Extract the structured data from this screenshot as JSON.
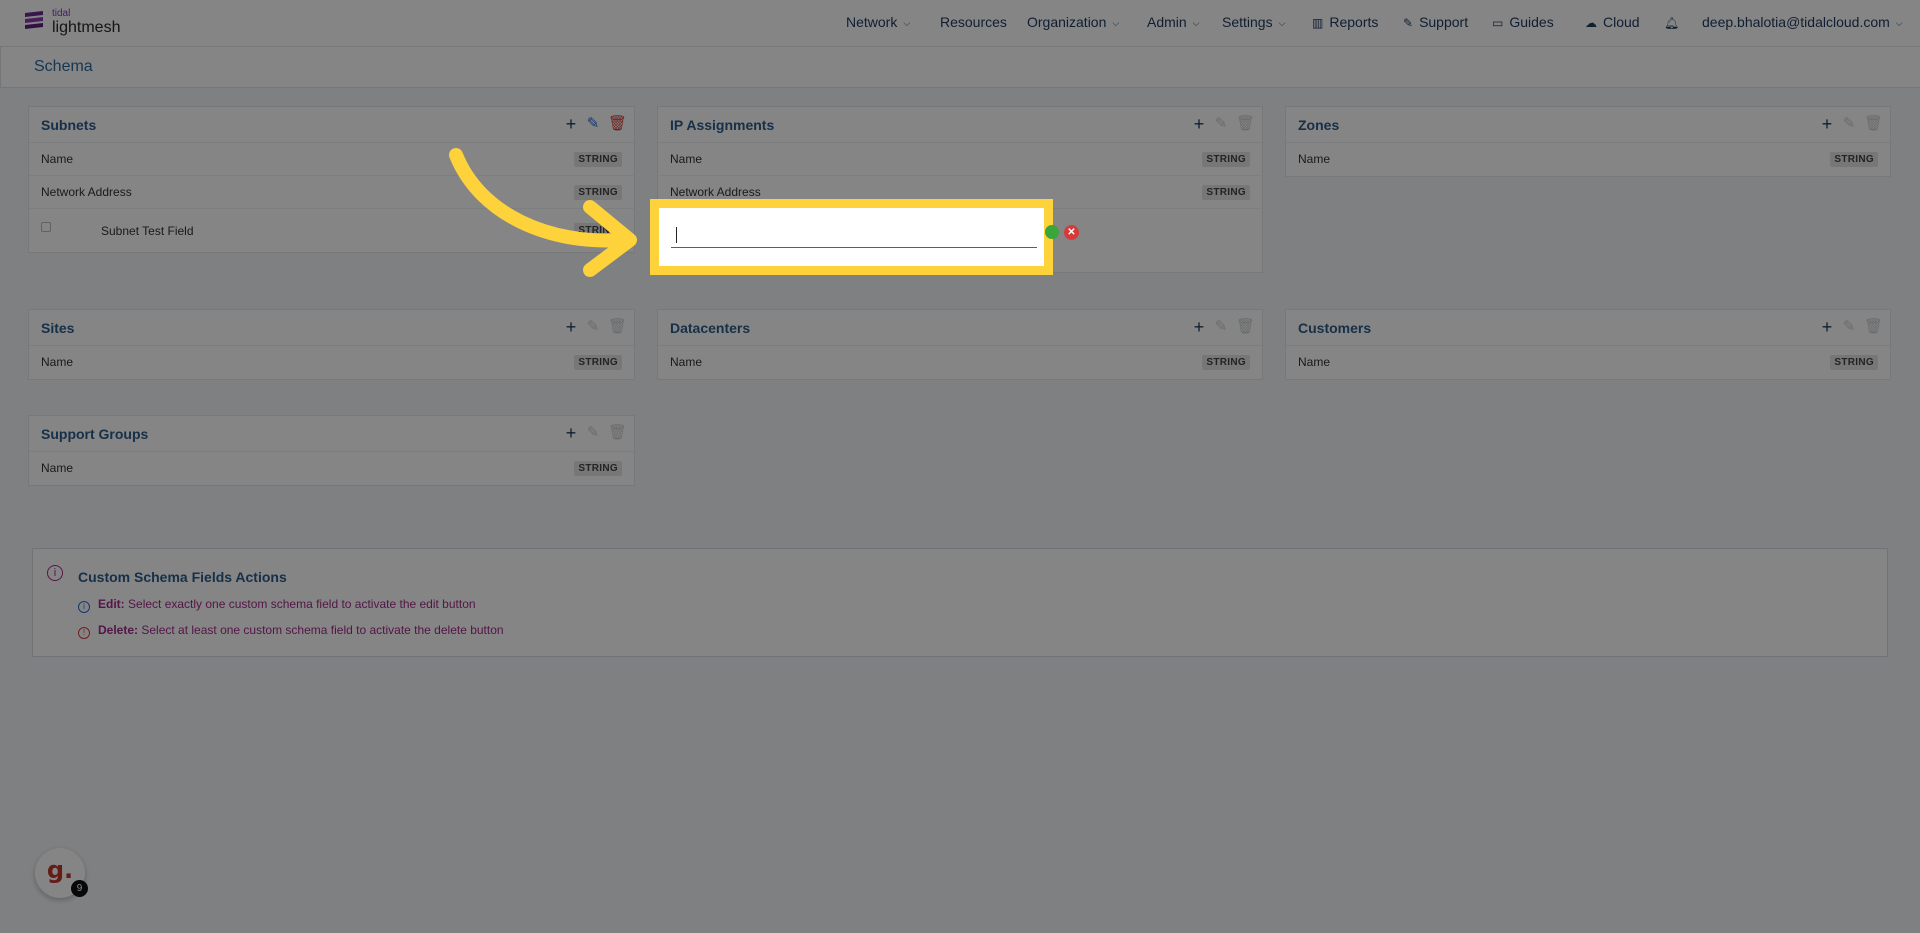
{
  "brand": {
    "small": "tidal",
    "big": "lightmesh"
  },
  "nav": {
    "network": "Network",
    "resources": "Resources",
    "organization": "Organization",
    "admin": "Admin",
    "settings": "Settings",
    "reports": "Reports",
    "support": "Support",
    "guides": "Guides",
    "cloud": "Cloud",
    "user": "deep.bhalotia@tidalcloud.com"
  },
  "page_title": "Schema",
  "badge_text": "STRING",
  "cards": {
    "subnets": {
      "title": "Subnets",
      "rows": [
        "Name",
        "Network Address"
      ],
      "custom_field": "Subnet Test Field"
    },
    "ip_assignments": {
      "title": "IP Assignments",
      "rows": [
        "Name",
        "Network Address"
      ]
    },
    "zones": {
      "title": "Zones",
      "rows": [
        "Name"
      ]
    },
    "sites": {
      "title": "Sites",
      "rows": [
        "Name"
      ]
    },
    "datacenters": {
      "title": "Datacenters",
      "rows": [
        "Name"
      ]
    },
    "customers": {
      "title": "Customers",
      "rows": [
        "Name"
      ]
    },
    "support_groups": {
      "title": "Support Groups",
      "rows": [
        "Name"
      ]
    }
  },
  "new_field_input": {
    "value": "",
    "placeholder": ""
  },
  "info": {
    "title": "Custom Schema Fields Actions",
    "edit_tag": "Edit:",
    "edit_text": "Select exactly one custom schema field to activate the edit button",
    "delete_tag": "Delete:",
    "delete_text": "Select at least one custom schema field to activate the delete button"
  },
  "guide_badge": {
    "letter": "g.",
    "count": "9"
  },
  "colors": {
    "highlight": "#fdd23a",
    "primary": "#2c5d8a",
    "danger": "#d83a3a",
    "info_text": "#a22b8a"
  }
}
